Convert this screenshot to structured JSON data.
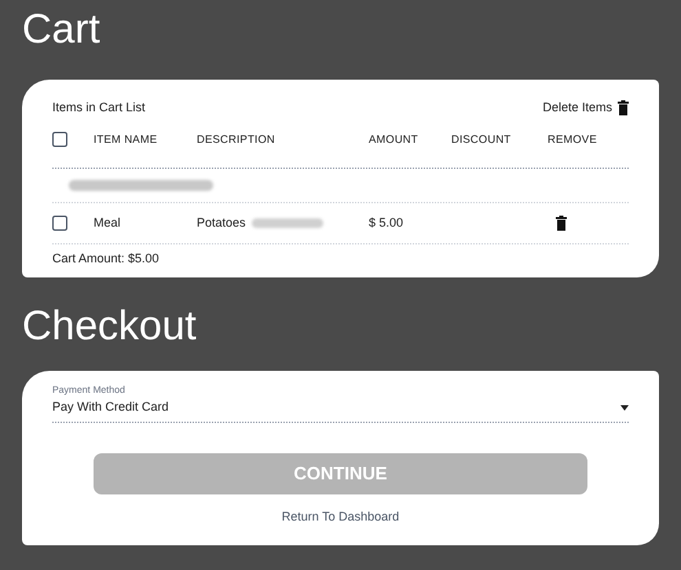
{
  "cart": {
    "title": "Cart",
    "list_title": "Items in Cart List",
    "delete_label": "Delete Items",
    "select_all_checked": false,
    "columns": [
      "ITEM NAME",
      "DESCRIPTION",
      "AMOUNT",
      "DISCOUNT",
      "REMOVE"
    ],
    "rows": [
      {
        "checked": false,
        "name": "Meal",
        "description": "Potatoes",
        "amount": "$ 5.00"
      }
    ],
    "total": "Cart Amount: $5.00"
  },
  "checkout": {
    "title": "Checkout",
    "payment_label": "Payment Method",
    "payment_value": "Pay With Credit Card",
    "continue": "CONTINUE",
    "continue_disabled": true,
    "back_link": "Return To Dashboard"
  }
}
